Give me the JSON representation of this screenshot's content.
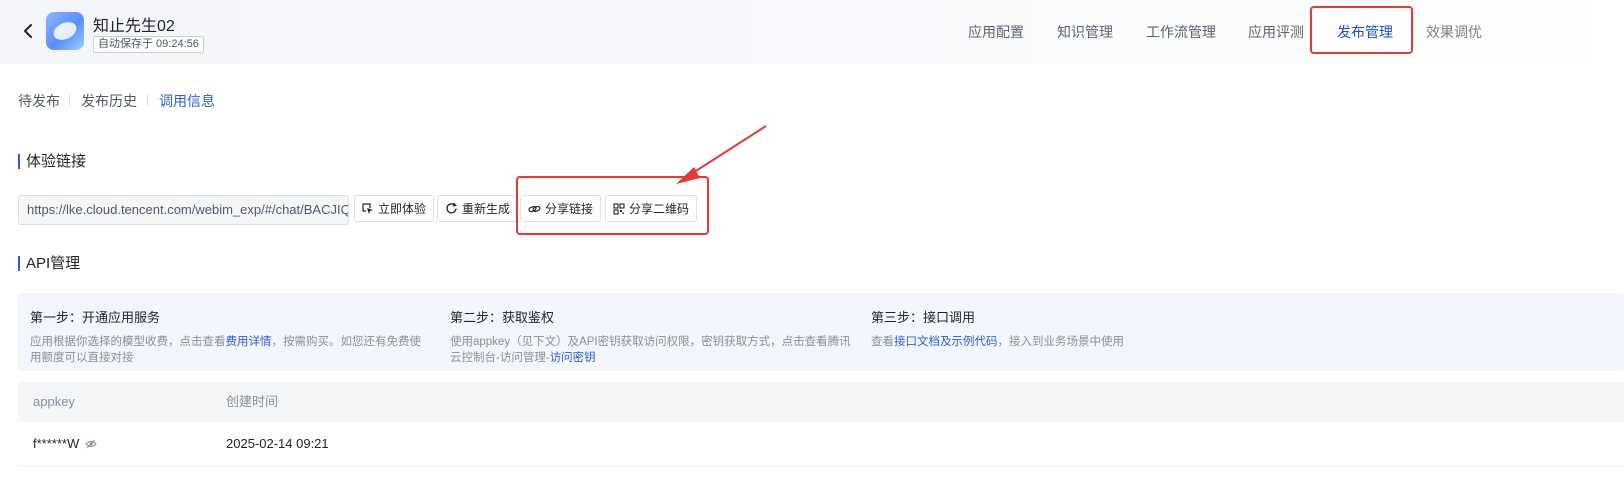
{
  "header": {
    "app_name": "知止先生02",
    "autosave": "自动保存于 09:24:56"
  },
  "nav": {
    "items": [
      {
        "label": "应用配置"
      },
      {
        "label": "知识管理"
      },
      {
        "label": "工作流管理"
      },
      {
        "label": "应用评测"
      },
      {
        "label": "发布管理",
        "active": true
      },
      {
        "label": "效果调优"
      }
    ]
  },
  "subtabs": {
    "items": [
      {
        "label": "待发布"
      },
      {
        "label": "发布历史"
      },
      {
        "label": "调用信息",
        "active": true
      }
    ]
  },
  "experience": {
    "title": "体验链接",
    "url": "https://lke.cloud.tencent.com/webim_exp/#/chat/BACJIQ",
    "try_now": "立即体验",
    "regenerate": "重新生成",
    "share_link": "分享链接",
    "share_qr": "分享二维码"
  },
  "api": {
    "title": "API管理",
    "steps": [
      {
        "title": "第一步：开通应用服务",
        "desc_prefix": "应用根据你选择的模型收费，点击查看",
        "desc_link": "费用详情",
        "desc_suffix": "，按需购买。如您还有免费使用额度可以直接对接"
      },
      {
        "title": "第二步：获取鉴权",
        "desc_prefix": "使用appkey（见下文）及API密钥获取访问权限，密钥获取方式，点击查看腾讯云控制台-访问管理-",
        "desc_link": "访问密钥",
        "desc_suffix": ""
      },
      {
        "title": "第三步：接口调用",
        "desc_prefix": "查看",
        "desc_link": "接口文档及示例代码",
        "desc_suffix": "，接入到业务场景中使用"
      }
    ],
    "table": {
      "columns": [
        "appkey",
        "创建时间"
      ],
      "rows": [
        {
          "appkey": "f******W",
          "created": "2025-02-14 09:21"
        }
      ]
    }
  },
  "colors": {
    "accent": "#2b5fd9",
    "highlight": "#e53935"
  }
}
